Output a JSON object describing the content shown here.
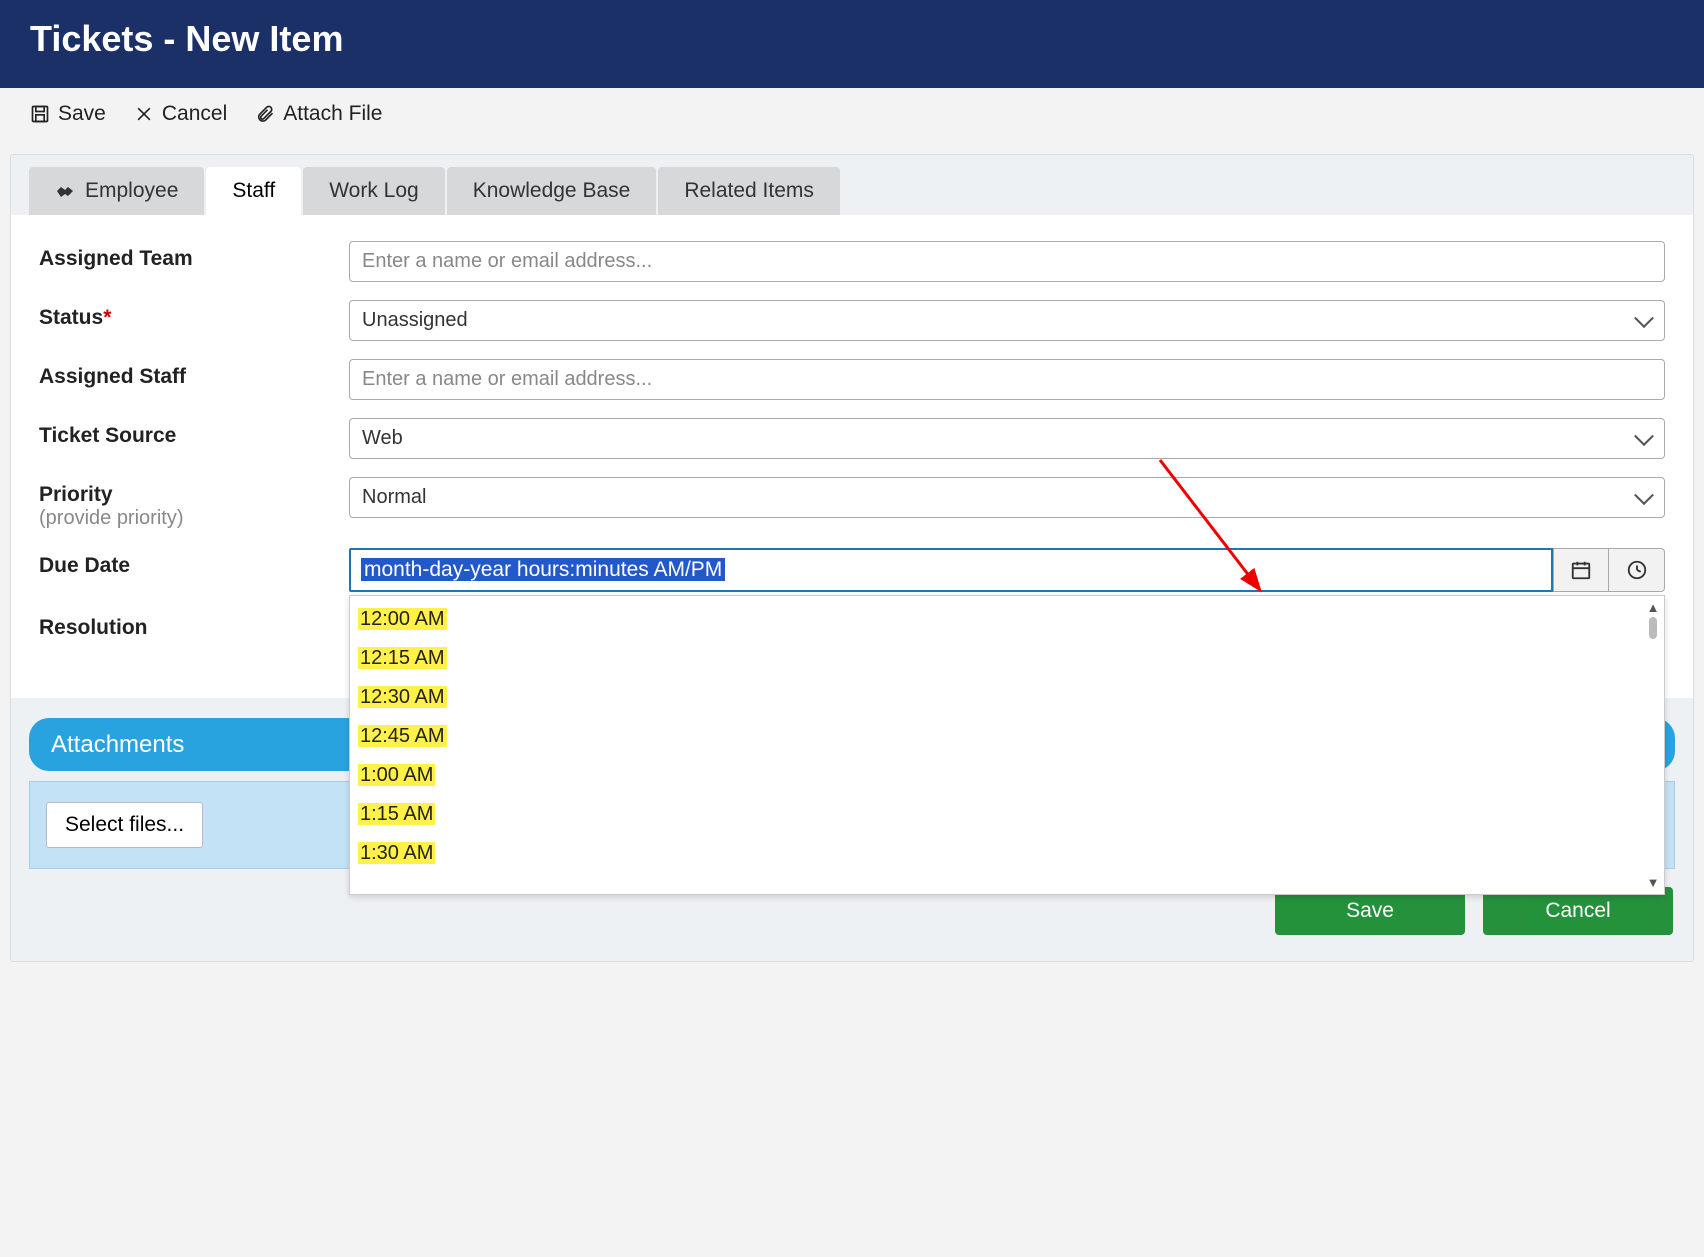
{
  "header": {
    "title": "Tickets - New Item"
  },
  "toolbar": {
    "save_label": "Save",
    "cancel_label": "Cancel",
    "attach_label": "Attach File"
  },
  "tabs": {
    "employee": "Employee",
    "staff": "Staff",
    "work_log": "Work Log",
    "knowledge_base": "Knowledge Base",
    "related_items": "Related Items"
  },
  "form": {
    "assigned_team": {
      "label": "Assigned Team",
      "placeholder": "Enter a name or email address..."
    },
    "status": {
      "label": "Status",
      "required_mark": "*",
      "value": "Unassigned"
    },
    "assigned_staff": {
      "label": "Assigned Staff",
      "placeholder": "Enter a name or email address..."
    },
    "ticket_source": {
      "label": "Ticket Source",
      "value": "Web"
    },
    "priority": {
      "label": "Priority",
      "hint": "(provide priority)",
      "value": "Normal"
    },
    "due_date": {
      "label": "Due Date",
      "placeholder": "month-day-year hours:minutes AM/PM"
    },
    "resolution": {
      "label": "Resolution"
    }
  },
  "time_options": [
    "12:00 AM",
    "12:15 AM",
    "12:30 AM",
    "12:45 AM",
    "1:00 AM",
    "1:15 AM",
    "1:30 AM"
  ],
  "attachments": {
    "title": "Attachments",
    "select_files": "Select files..."
  },
  "footer": {
    "save": "Save",
    "cancel": "Cancel"
  }
}
